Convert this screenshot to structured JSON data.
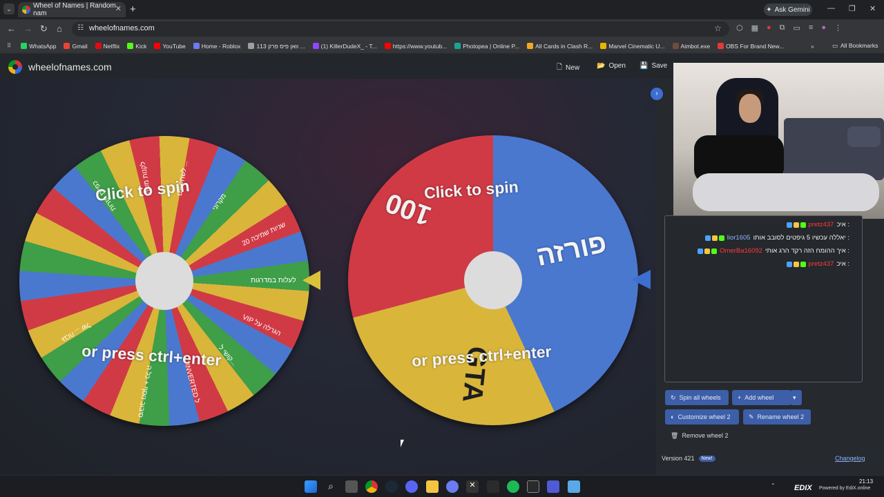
{
  "browser": {
    "tab_title": "Wheel of Names | Random nam",
    "url": "wheelofnames.com",
    "gemini_label": "Ask Gemini",
    "bookmarks": [
      {
        "label": "WhatsApp",
        "color": "#25d366"
      },
      {
        "label": "Gmail",
        "color": "#ea4335"
      },
      {
        "label": "Netflix",
        "color": "#e50914"
      },
      {
        "label": "Kick",
        "color": "#53fc18"
      },
      {
        "label": "YouTube",
        "color": "#ff0000"
      },
      {
        "label": "Home - Roblox",
        "color": "#6b7bf0"
      },
      {
        "label": "וואן פיס פרק 113 ...",
        "color": "#9e9e9e"
      },
      {
        "label": "(1) KillerDudeX_ - T...",
        "color": "#9146ff"
      },
      {
        "label": "https://www.youtub...",
        "color": "#ff0000"
      },
      {
        "label": "Photopea | Online P...",
        "color": "#18a497"
      },
      {
        "label": "All Cards in Clash R...",
        "color": "#f5a623"
      },
      {
        "label": "Marvel Cinematic U...",
        "color": "#e8b600"
      },
      {
        "label": "Aimbot.exe",
        "color": "#6d4c41"
      },
      {
        "label": "OBS For Brand New...",
        "color": "#e53935"
      }
    ],
    "all_bookmarks": "All Bookmarks"
  },
  "app": {
    "site_name": "wheelofnames.com",
    "new_label": "New",
    "open_label": "Open",
    "save_label": "Save"
  },
  "wheels": {
    "wheel1": {
      "click_text": "Click to spin",
      "press_text": "or press ctrl+enter",
      "segment_labels": [
        "לעלות במדרגות",
        "VIP הגרלה על",
        "קושי ל...",
        "INVERTED ל",
        "סיבוב נוסף + כל ה",
        "20 שניות שמיכה",
        "מקרוני",
        "לשחק עם ...",
        "לקנות משהו",
        "כפיות חזרות",
        "גבוה ... של"
      ]
    },
    "wheel2": {
      "click_text": "Click to spin",
      "press_text": "or press ctrl+enter",
      "segment_labels": [
        "פורזה",
        "GTA",
        "100"
      ],
      "colors": {
        "red": "#d03a45",
        "blue": "#4a78cf",
        "yellow": "#d9b53a"
      }
    }
  },
  "chat": [
    {
      "user": "pretz437",
      "message": "איכ :",
      "user_class": ""
    },
    {
      "user": "lior1605",
      "message": "יאללה עכשיו 5 גיפטים לסובב אותו :",
      "user_class": "blue"
    },
    {
      "user": "OmerBa16092",
      "message": "איך ההומח הזה רקד הרג אותי :",
      "user_class": ""
    },
    {
      "user": "pretz437",
      "message": "איכ :",
      "user_class": ""
    }
  ],
  "panel": {
    "spin_all_label": "Spin all wheels",
    "add_wheel_label": "Add wheel",
    "customize_label": "Customize wheel 2",
    "rename_label": "Rename wheel 2",
    "remove_label": "Remove wheel 2",
    "version_label": "Version 421",
    "new_badge": "New!",
    "changelog_label": "Changelog"
  },
  "system": {
    "time": "21:13",
    "watermark": "EDIX",
    "powered": "Powered by EdiX.online"
  }
}
